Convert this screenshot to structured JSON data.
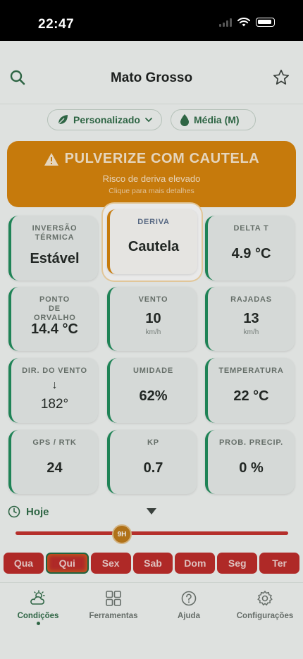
{
  "status_bar": {
    "time": "22:47"
  },
  "header": {
    "title": "Mato Grosso"
  },
  "filters": {
    "mode": "Personalizado",
    "droplet": "Média (M)"
  },
  "alert": {
    "title": "PULVERIZE COM CAUTELA",
    "subtitle": "Risco de deriva elevado",
    "hint": "Clique para mais detalhes",
    "color": "#d9840a"
  },
  "cards": {
    "inversao": {
      "label": "INVERSÃO TÉRMICA",
      "value": "Estável"
    },
    "deriva": {
      "label": "DERIVA",
      "value": "Cautela"
    },
    "delta_t": {
      "label": "DELTA T",
      "value": "4.9 °C"
    },
    "ponto_orvalho": {
      "label": "PONTO DE ORVALHO",
      "value": "14.4 °C"
    },
    "vento": {
      "label": "VENTO",
      "value": "10",
      "unit": "km/h"
    },
    "rajadas": {
      "label": "RAJADAS",
      "value": "13",
      "unit": "km/h"
    },
    "dir_vento": {
      "label": "DIR. DO VENTO",
      "arrow": "↓",
      "value": "182°"
    },
    "umidade": {
      "label": "UMIDADE",
      "value": "62%"
    },
    "temperatura": {
      "label": "TEMPERATURA",
      "value": "22 °C"
    },
    "gps": {
      "label": "GPS / RTK",
      "value": "24"
    },
    "kp": {
      "label": "KP",
      "value": "0.7"
    },
    "prob_precip": {
      "label": "PROB. PRECIP.",
      "value": "0 %"
    }
  },
  "timeline": {
    "day_label": "Hoje",
    "hour": "9H"
  },
  "days": [
    "Qua",
    "Qui",
    "Sex",
    "Sab",
    "Dom",
    "Seg",
    "Ter"
  ],
  "selected_day": "Qui",
  "tabs": {
    "conditions": "Condições",
    "tools": "Ferramentas",
    "help": "Ajuda",
    "settings": "Configurações"
  },
  "colors": {
    "accent_green": "#2f6c48",
    "caution_orange": "#d9840a",
    "bad_red": "#bf2a28"
  }
}
